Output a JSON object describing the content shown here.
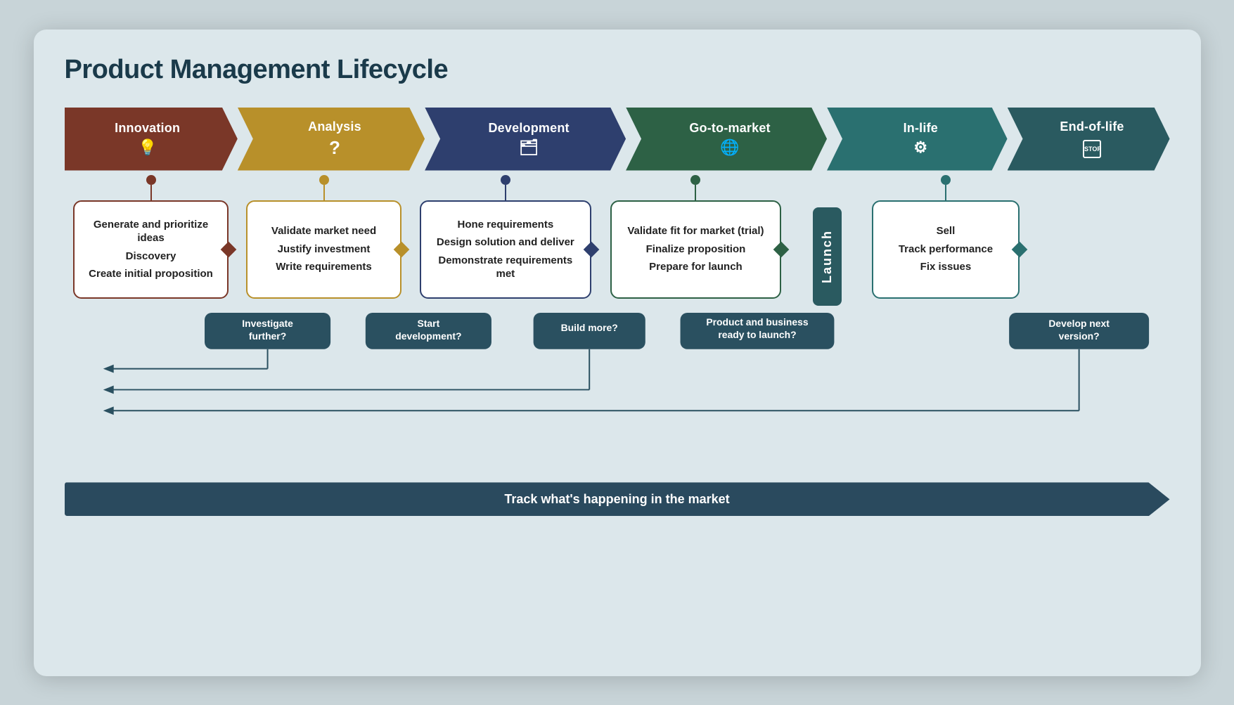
{
  "title": "Product Management Lifecycle",
  "phases": [
    {
      "id": "innovation",
      "label": "Innovation",
      "icon": "💡",
      "color": "#7a3728",
      "boxItems": [
        "Generate and prioritize ideas",
        "Discovery",
        "Create initial proposition"
      ],
      "dotClass": "dot-innovation",
      "lineClass": "line-innovation",
      "boxClass": "box-innovation",
      "diamondClass": "diamond-innovation"
    },
    {
      "id": "analysis",
      "label": "Analysis",
      "icon": "?",
      "color": "#b8902a",
      "boxItems": [
        "Validate market need",
        "Justify investment",
        "Write requirements"
      ],
      "dotClass": "dot-analysis",
      "lineClass": "line-analysis",
      "boxClass": "box-analysis",
      "diamondClass": "diamond-analysis"
    },
    {
      "id": "development",
      "label": "Development",
      "icon": "🗂",
      "color": "#2e3f6e",
      "boxItems": [
        "Hone requirements",
        "Design solution and deliver",
        "Demonstrate requirements met"
      ],
      "dotClass": "dot-development",
      "lineClass": "line-development",
      "boxClass": "box-development",
      "diamondClass": "diamond-development"
    },
    {
      "id": "gtm",
      "label": "Go-to-market",
      "icon": "🌐",
      "color": "#2d6145",
      "boxItems": [
        "Validate fit for market (trial)",
        "Finalize proposition",
        "Prepare for launch"
      ],
      "dotClass": "dot-gtm",
      "lineClass": "line-gtm",
      "boxClass": "box-gtm",
      "diamondClass": "diamond-gtm"
    },
    {
      "id": "launch",
      "label": "Launch",
      "color": "#2a5a60",
      "isLaunch": true
    },
    {
      "id": "inlife",
      "label": "In-life",
      "icon": "⚙",
      "color": "#2a7070",
      "boxItems": [
        "Sell",
        "Track performance",
        "Fix issues"
      ],
      "dotClass": "dot-inlife",
      "lineClass": "line-inlife",
      "boxClass": "box-inlife",
      "diamondClass": "diamond-inlife"
    },
    {
      "id": "eol",
      "label": "End-of-life",
      "icon": "STOP",
      "color": "#2a5a60",
      "isEol": true
    }
  ],
  "decisions": [
    {
      "id": "investigate",
      "text": "Investigate further?"
    },
    {
      "id": "start-dev",
      "text": "Start development?"
    },
    {
      "id": "build-more",
      "text": "Build more?"
    },
    {
      "id": "ready-launch",
      "text": "Product and business ready to launch?"
    },
    {
      "id": "next-version",
      "text": "Develop next version?"
    }
  ],
  "trackMarket": "Track what's happening in the market"
}
